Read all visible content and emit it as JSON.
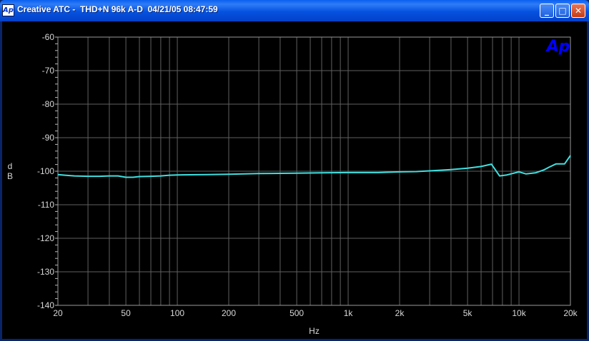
{
  "window": {
    "title": "Creative ATC -  THD+N 96k A-D  04/21/05 08:47:59",
    "icon": "ap-app-icon",
    "controls": {
      "minimize": "_",
      "maximize": "□",
      "close": "✕"
    }
  },
  "logo": {
    "text": "Ap",
    "color": "#0000ff"
  },
  "chart_data": {
    "type": "line",
    "title": "",
    "xlabel": "Hz",
    "ylabel": "d\nB",
    "xscale": "log",
    "xlim": [
      20,
      20000
    ],
    "ylim": [
      -140,
      -60
    ],
    "x_ticks": [
      {
        "v": 20,
        "label": "20"
      },
      {
        "v": 50,
        "label": "50"
      },
      {
        "v": 100,
        "label": "100"
      },
      {
        "v": 200,
        "label": "200"
      },
      {
        "v": 500,
        "label": "500"
      },
      {
        "v": 1000,
        "label": "1k"
      },
      {
        "v": 2000,
        "label": "2k"
      },
      {
        "v": 5000,
        "label": "5k"
      },
      {
        "v": 10000,
        "label": "10k"
      },
      {
        "v": 20000,
        "label": "20k"
      }
    ],
    "y_ticks": [
      -60,
      -70,
      -80,
      -90,
      -100,
      -110,
      -120,
      -130,
      -140
    ],
    "grid": true,
    "background": "#000000",
    "grid_color": "#606060",
    "series": [
      {
        "color": "#40e0e0",
        "points": [
          [
            20,
            -101.0
          ],
          [
            22,
            -101.2
          ],
          [
            25,
            -101.4
          ],
          [
            30,
            -101.5
          ],
          [
            35,
            -101.5
          ],
          [
            40,
            -101.4
          ],
          [
            45,
            -101.4
          ],
          [
            50,
            -101.8
          ],
          [
            55,
            -101.8
          ],
          [
            60,
            -101.6
          ],
          [
            70,
            -101.5
          ],
          [
            80,
            -101.4
          ],
          [
            90,
            -101.2
          ],
          [
            100,
            -101.1
          ],
          [
            150,
            -101.0
          ],
          [
            200,
            -100.9
          ],
          [
            300,
            -100.7
          ],
          [
            500,
            -100.6
          ],
          [
            700,
            -100.5
          ],
          [
            1000,
            -100.4
          ],
          [
            1500,
            -100.4
          ],
          [
            2000,
            -100.2
          ],
          [
            2500,
            -100.1
          ],
          [
            3000,
            -99.9
          ],
          [
            4000,
            -99.5
          ],
          [
            5000,
            -99.1
          ],
          [
            6000,
            -98.6
          ],
          [
            6900,
            -97.9
          ],
          [
            7700,
            -101.4
          ],
          [
            8500,
            -101.1
          ],
          [
            10000,
            -100.2
          ],
          [
            11000,
            -100.8
          ],
          [
            12500,
            -100.5
          ],
          [
            14000,
            -99.6
          ],
          [
            15000,
            -98.8
          ],
          [
            16500,
            -97.8
          ],
          [
            18500,
            -97.8
          ],
          [
            20000,
            -95.3
          ]
        ]
      }
    ]
  }
}
